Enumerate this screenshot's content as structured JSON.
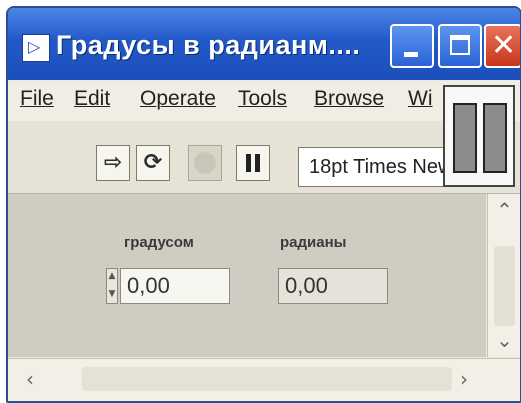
{
  "window": {
    "title": "Градусы в радианм....",
    "icons": {
      "app": "labview-vi-icon",
      "minimize": "minimize-icon",
      "maximize": "maximize-icon",
      "close": "close-icon"
    }
  },
  "menu": {
    "items": [
      "File",
      "Edit",
      "Operate",
      "Tools",
      "Browse",
      "Wi"
    ]
  },
  "toolbar": {
    "icons": [
      "run-arrow-icon",
      "run-continuously-icon",
      "abort-icon",
      "pause-icon"
    ],
    "font_selector": "18pt Times New"
  },
  "panel": {
    "degrees": {
      "label": "градусом",
      "value": "0,00"
    },
    "radians": {
      "label": "радианы",
      "value": "0,00"
    }
  },
  "colors": {
    "titlebar": "#2259c9",
    "panel": "#cfcdc2",
    "menubar": "#f0eee4"
  }
}
